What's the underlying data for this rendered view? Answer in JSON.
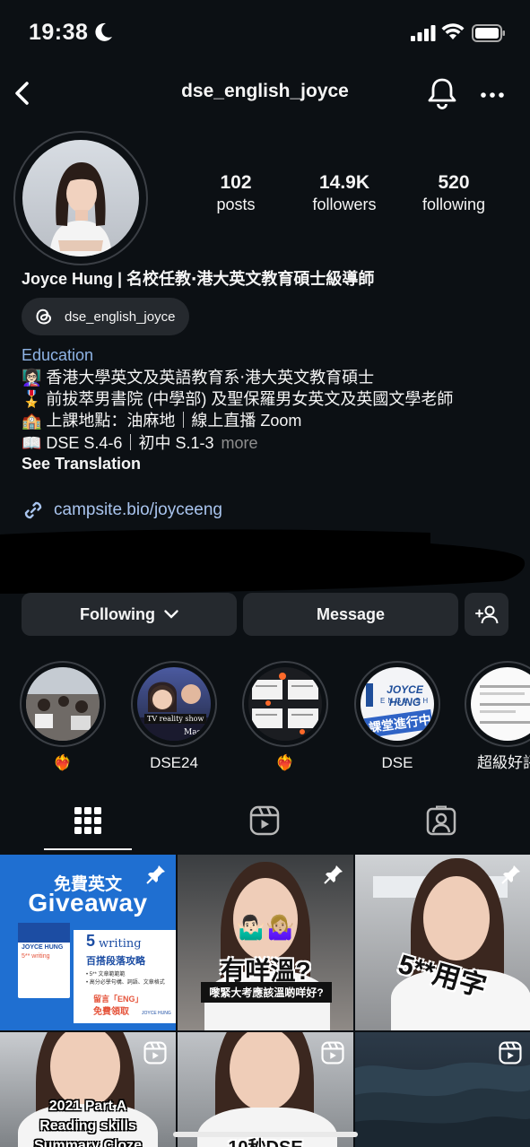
{
  "status_bar": {
    "time": "19:38"
  },
  "header": {
    "username": "dse_english_joyce"
  },
  "stats": [
    {
      "value": "102",
      "label": "posts"
    },
    {
      "value": "14.9K",
      "label": "followers"
    },
    {
      "value": "520",
      "label": "following"
    }
  ],
  "profile": {
    "name": "Joyce Hung | 名校任教‧港大英文教育碩士級導師",
    "threads_handle": "dse_english_joyce",
    "category": "Education",
    "bio_lines": [
      "👩🏻‍🏫 香港大學英文及英語教育系‧港大英文教育碩士",
      "🎖️ 前拔萃男書院 (中學部) 及聖保羅男女英文及英國文學老師",
      "🏫 上課地點：油麻地｜線上直播 Zoom",
      "📖 DSE S.4-6｜初中 S.1-3"
    ],
    "more_label": "more",
    "see_translation": "See Translation",
    "link": "campsite.bio/joyceeng"
  },
  "actions": {
    "following": "Following",
    "message": "Message"
  },
  "highlights": [
    {
      "caption": "❤️‍🔥"
    },
    {
      "caption": "DSE24"
    },
    {
      "caption": "❤️‍🔥"
    },
    {
      "caption": "DSE"
    },
    {
      "caption": "超級好評"
    }
  ],
  "highlight_images": {
    "dse24_banner": "TV reality show",
    "dse24_corner": "Mas",
    "dse_logo": "JOYCE HUNG",
    "dse_logo_sub": "ENGLISH",
    "dse_sign": "課堂進行中"
  },
  "grid": {
    "post1": {
      "top": "免費英文",
      "title": "Giveaway",
      "book_num": "5",
      "book_title": "writing",
      "book_sub": "百搭段落攻略",
      "cover_title": "JOYCE HUNG",
      "cover_sub": "5** writing",
      "bullets": "• 5** 文章範範範\n• 高分必學句構、詞語、文章格式",
      "cta1": "留言「ENG」",
      "cta2": "免費領取",
      "brand": "JOYCE HUNG"
    },
    "post2": {
      "emoji": "🤷🏻‍♂️🤷🏼‍♀️",
      "title": "有咩溫?",
      "subtitle": "嚟緊大考應該溫啲咩好?"
    },
    "post3": {
      "title": "5**用字"
    },
    "post4": {
      "line1": "2021 Part A",
      "line2": "Reading skills",
      "line3": "Summary Cloze"
    },
    "post5": {
      "title": "10秒DSE"
    }
  },
  "colors": {
    "background": "#0c1014",
    "button": "#25292e",
    "link": "#a9c4ee",
    "category": "#8fb4e6",
    "giveaway_blue": "#1f6fd1"
  }
}
